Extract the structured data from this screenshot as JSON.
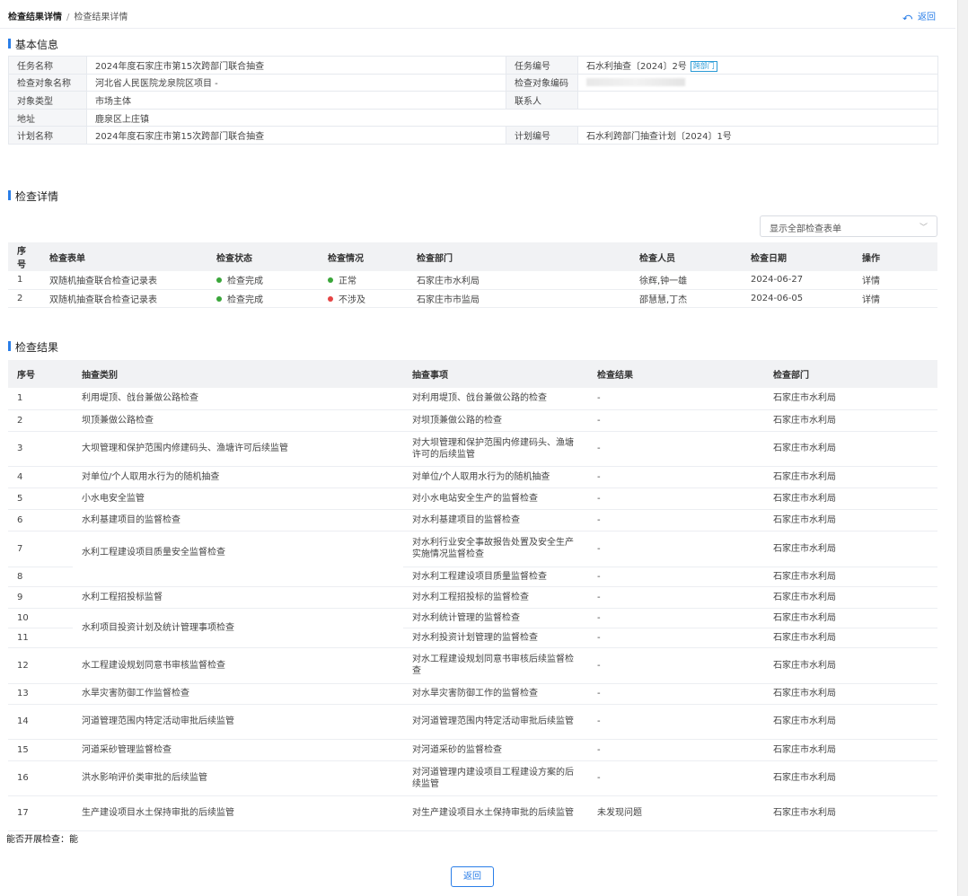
{
  "breadcrumb": {
    "current": "检查结果详情",
    "separator": "/",
    "sub": "检查结果详情"
  },
  "back": {
    "icon": "undo-icon",
    "label": "返回"
  },
  "sections": {
    "basic": "基本信息",
    "detail": "检查详情",
    "result": "检查结果"
  },
  "basic": {
    "task_name_label": "任务名称",
    "task_name": "2024年度石家庄市第15次跨部门联合抽查",
    "task_no_label": "任务编号",
    "task_no": "石水利抽查〔2024〕2号",
    "task_tag": "跨部门",
    "target_name_label": "检查对象名称",
    "target_name": "河北省人民医院龙泉院区项目 -",
    "target_code_label": "检查对象编码",
    "type_label": "对象类型",
    "type": "市场主体",
    "contact_label": "联系人",
    "contact": "",
    "address_label": "地址",
    "address": "鹿泉区上庄镇",
    "plan_name_label": "计划名称",
    "plan_name": "2024年度石家庄市第15次跨部门联合抽查",
    "plan_no_label": "计划编号",
    "plan_no": "石水利跨部门抽查计划〔2024〕1号"
  },
  "filter": {
    "selected": "显示全部检查表单"
  },
  "detail_table": {
    "headers": [
      "序号",
      "检查表单",
      "检查状态",
      "检查情况",
      "检查部门",
      "检查人员",
      "检查日期",
      "操作"
    ],
    "rows": [
      {
        "no": "1",
        "form": "双随机抽查联合检查记录表",
        "status": "检查完成",
        "situation": "正常",
        "dept": "石家庄市水利局",
        "staff": "徐辉,钟一雄",
        "date": "2024-06-27",
        "action": "详情"
      },
      {
        "no": "2",
        "form": "双随机抽查联合检查记录表",
        "status": "检查完成",
        "situation": "不涉及",
        "dept": "石家庄市市监局",
        "staff": "邵慧慧,丁杰",
        "date": "2024-06-05",
        "action": "详情"
      }
    ]
  },
  "result_table": {
    "headers": [
      "序号",
      "抽查类别",
      "抽查事项",
      "检查结果",
      "检查部门"
    ],
    "rows": [
      {
        "no": "1",
        "category": "利用堤顶、戗台兼做公路检查",
        "item": "对利用堤顶、戗台兼做公路的检查",
        "result": "-",
        "dept": "石家庄市水利局"
      },
      {
        "no": "2",
        "category": "坝顶兼做公路检查",
        "item": "对坝顶兼做公路的检查",
        "result": "-",
        "dept": "石家庄市水利局"
      },
      {
        "no": "3",
        "category": "大坝管理和保护范围内修建码头、渔塘许可后续监管",
        "item": "对大坝管理和保护范围内修建码头、渔塘许可的后续监管",
        "result": "-",
        "dept": "石家庄市水利局"
      },
      {
        "no": "4",
        "category": "对单位/个人取用水行为的随机抽查",
        "item": "对单位/个人取用水行为的随机抽查",
        "result": "-",
        "dept": "石家庄市水利局"
      },
      {
        "no": "5",
        "category": "小水电安全监管",
        "item": "对小水电站安全生产的监督检查",
        "result": "-",
        "dept": "石家庄市水利局"
      },
      {
        "no": "6",
        "category": "水利基建项目的监督检查",
        "item": "对水利基建项目的监督检查",
        "result": "-",
        "dept": "石家庄市水利局"
      },
      {
        "no": "7",
        "category": "水利工程建设项目质量安全监督检查",
        "item": "对水利行业安全事故报告处置及安全生产实施情况监督检查",
        "result": "-",
        "dept": "石家庄市水利局"
      },
      {
        "no": "8",
        "category": "",
        "item": "对水利工程建设项目质量监督检查",
        "result": "-",
        "dept": "石家庄市水利局"
      },
      {
        "no": "9",
        "category": "水利工程招投标监督",
        "item": "对水利工程招投标的监督检查",
        "result": "-",
        "dept": "石家庄市水利局"
      },
      {
        "no": "10",
        "category": "水利项目投资计划及统计管理事项检查",
        "item": "对水利统计管理的监督检查",
        "result": "-",
        "dept": "石家庄市水利局"
      },
      {
        "no": "11",
        "category": "",
        "item": "对水利投资计划管理的监督检查",
        "result": "-",
        "dept": "石家庄市水利局"
      },
      {
        "no": "12",
        "category": "水工程建设规划同意书审核监督检查",
        "item": "对水工程建设规划同意书审核后续监督检查",
        "result": "-",
        "dept": "石家庄市水利局"
      },
      {
        "no": "13",
        "category": "水旱灾害防御工作监督检查",
        "item": "对水旱灾害防御工作的监督检查",
        "result": "-",
        "dept": "石家庄市水利局"
      },
      {
        "no": "14",
        "category": "河道管理范围内特定活动审批后续监管",
        "item": "对河道管理范围内特定活动审批后续监管",
        "result": "-",
        "dept": "石家庄市水利局"
      },
      {
        "no": "15",
        "category": "河道采砂管理监督检查",
        "item": "对河道采砂的监督检查",
        "result": "-",
        "dept": "石家庄市水利局"
      },
      {
        "no": "16",
        "category": "洪水影响评价类审批的后续监管",
        "item": "对河道管理内建设项目工程建设方案的后续监管",
        "result": "-",
        "dept": "石家庄市水利局"
      },
      {
        "no": "17",
        "category": "生产建设项目水土保持审批的后续监管",
        "item": "对生产建设项目水土保持审批的后续监管",
        "result": "未发现问题",
        "dept": "石家庄市水利局"
      }
    ]
  },
  "can_check": "能否开展检查：能",
  "bottom_back": "返回",
  "colors": {
    "accent": "#2a7ee8",
    "ok": "#3aa63a",
    "error": "#e54545"
  }
}
